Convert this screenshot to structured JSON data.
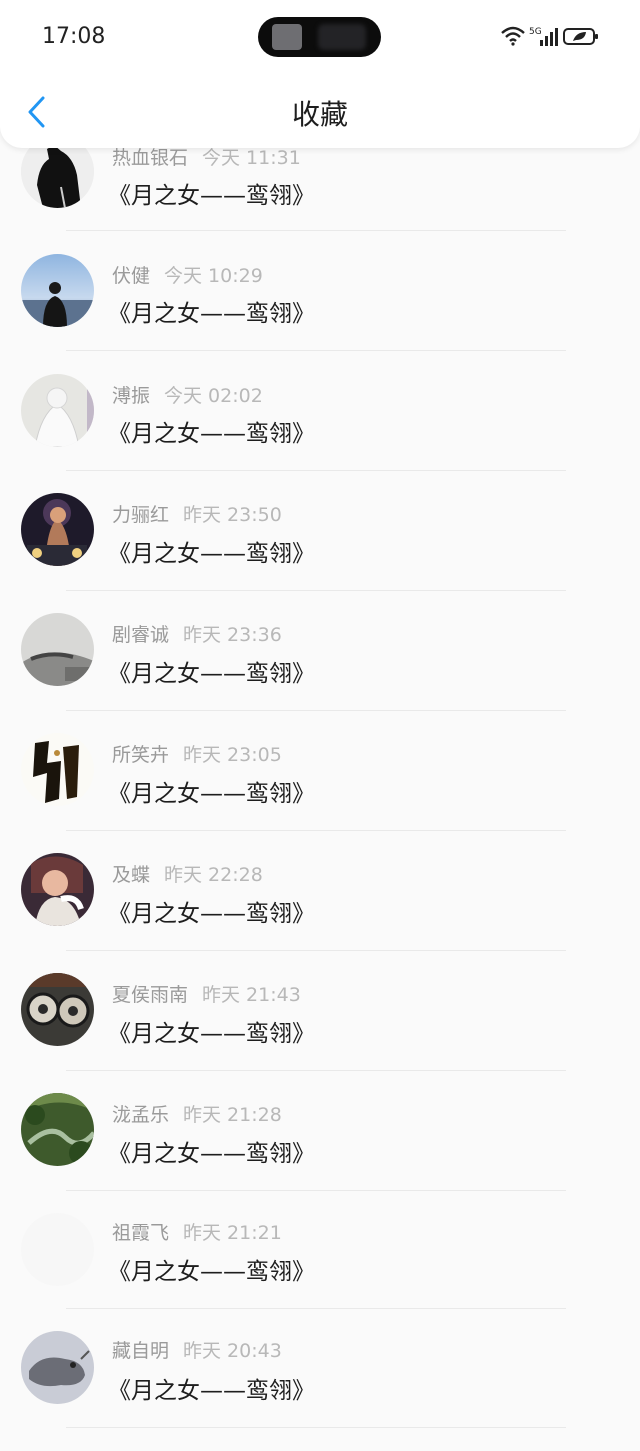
{
  "status_bar": {
    "time": "17:08",
    "network": "5G"
  },
  "header": {
    "title": "收藏"
  },
  "items": [
    {
      "name": "热血银石",
      "time": "今天 11:31",
      "title": "《月之女——鸾翎》"
    },
    {
      "name": "伏健",
      "time": "今天 10:29",
      "title": "《月之女——鸾翎》"
    },
    {
      "name": "溥振",
      "time": "今天 02:02",
      "title": "《月之女——鸾翎》"
    },
    {
      "name": "力骊红",
      "time": "昨天 23:50",
      "title": "《月之女——鸾翎》"
    },
    {
      "name": "剧睿诚",
      "time": "昨天 23:36",
      "title": "《月之女——鸾翎》"
    },
    {
      "name": "所笑卉",
      "time": "昨天 23:05",
      "title": "《月之女——鸾翎》"
    },
    {
      "name": "及蝶",
      "time": "昨天 22:28",
      "title": "《月之女——鸾翎》"
    },
    {
      "name": "夏侯雨南",
      "time": "昨天 21:43",
      "title": "《月之女——鸾翎》"
    },
    {
      "name": "泷孟乐",
      "time": "昨天 21:28",
      "title": "《月之女——鸾翎》"
    },
    {
      "name": "祖霞飞",
      "time": "昨天 21:21",
      "title": "《月之女——鸾翎》"
    },
    {
      "name": "藏自明",
      "time": "昨天 20:43",
      "title": "《月之女——鸾翎》"
    }
  ],
  "colors": {
    "accent": "#2196f3",
    "text": "#1e1e1e",
    "muted": "#9a9a9a"
  }
}
